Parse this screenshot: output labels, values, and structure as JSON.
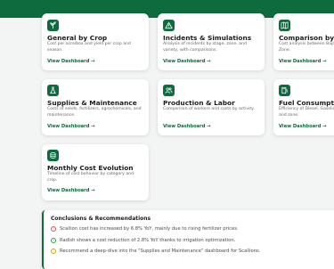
{
  "cards": [
    {
      "icon": "sprout-icon",
      "title": "General by Crop",
      "description": "Cost per acre/box and yield per crop and season.",
      "link": "View Dashboard →"
    },
    {
      "icon": "warning-icon",
      "title": "Incidents & Simulations",
      "description": "Analysis of incidents by stage, zone, and variety, with comparisons.",
      "link": "View Dashboard →"
    },
    {
      "icon": "map-icon",
      "title": "Comparison by Z",
      "description": "Cost analysis between Baja Zone.",
      "link": "View Dashboard →"
    },
    {
      "icon": "flask-icon",
      "title": "Supplies & Maintenance",
      "description": "Costs of seeds, fertilizers, agrochemicals, and maintenance.",
      "link": "View Dashboard →"
    },
    {
      "icon": "users-icon",
      "title": "Production & Labor",
      "description": "Comparison of workers and costs by activity.",
      "link": "View Dashboard →"
    },
    {
      "icon": "fuel-icon",
      "title": "Fuel Consumptic",
      "description": "Efficiency of Diesel, Gasoline and zone.",
      "link": "View Dashboard →"
    },
    {
      "icon": "coins-icon",
      "title": "Monthly Cost Evolution",
      "description": "Timeline of cost behavior by category and crop.",
      "link": "View Dashboard →"
    }
  ],
  "conclusions": {
    "title": "Conclusions & Recommendations",
    "items": [
      {
        "icon": "alert-circle-icon",
        "color": "#d9534f",
        "text": "Scallion cost has increased by 6.8% YoY, mainly due to rising fertilizer prices."
      },
      {
        "icon": "check-circle-icon",
        "color": "#28a745",
        "text": "Radish shows a cost reduction of 2.8% YoY thanks to irrigation optimization."
      },
      {
        "icon": "info-circle-icon",
        "color": "#e0a100",
        "text": "Recommend a deep-dive into the \"Supplies and Maintenance\" dashboard for Scallions."
      }
    ]
  }
}
